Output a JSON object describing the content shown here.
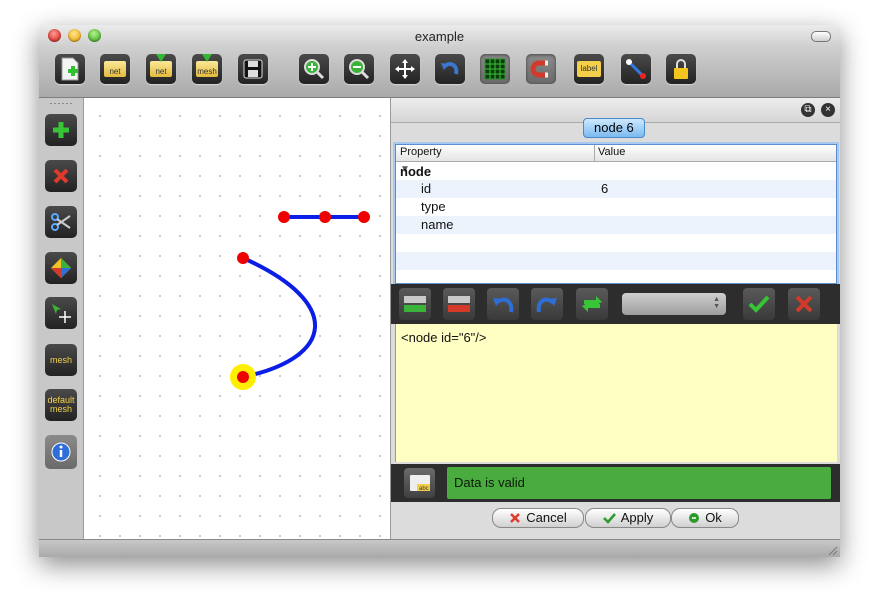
{
  "window": {
    "title": "example"
  },
  "toolbar": {
    "new_label": "",
    "open_net_label": "net",
    "import_net_label": "net",
    "import_mesh_label": "mesh",
    "label_tool_label": "label"
  },
  "sidebar": {
    "mesh_label": "mesh",
    "default_mesh_label_1": "default",
    "default_mesh_label_2": "mesh"
  },
  "panel": {
    "tab_title": "node 6",
    "table": {
      "col_property": "Property",
      "col_value": "Value",
      "group": "node",
      "rows": [
        {
          "property": "id",
          "value": "6"
        },
        {
          "property": "type",
          "value": ""
        },
        {
          "property": "name",
          "value": ""
        }
      ]
    },
    "editor_text": "<node id=\"6\"/>",
    "status_text": "Data is valid",
    "combo_value": ""
  },
  "buttons": {
    "cancel": "Cancel",
    "apply": "Apply",
    "ok": "Ok"
  },
  "colors": {
    "edge": "#0a1ee6",
    "node": "#ee0000",
    "highlight": "#ffee00",
    "valid": "#4aab3f",
    "editor_bg": "#ffffc4"
  }
}
